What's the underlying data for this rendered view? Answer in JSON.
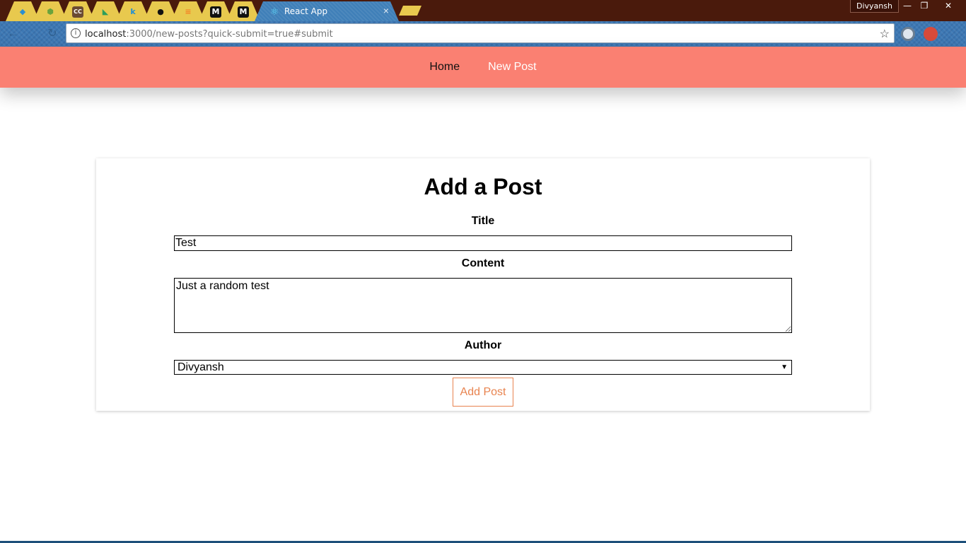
{
  "browser": {
    "tabs": [
      {
        "name": "tab-1",
        "icon": "bird-icon",
        "glyph": "◆",
        "color": "#2b8fd1"
      },
      {
        "name": "tab-2",
        "icon": "nodejs-icon",
        "glyph": "⬢",
        "color": "#6aa33c"
      },
      {
        "name": "tab-3",
        "icon": "cc-icon",
        "glyph": "CC",
        "color": "#6b4b33"
      },
      {
        "name": "tab-4",
        "icon": "maps-icon",
        "glyph": "◣",
        "color": "#2e9e5b"
      },
      {
        "name": "tab-5",
        "icon": "k-icon",
        "glyph": "k",
        "color": "#1e8ed6"
      },
      {
        "name": "tab-6",
        "icon": "github-icon",
        "glyph": "●",
        "color": "#111111"
      },
      {
        "name": "tab-7",
        "icon": "stackoverflow-icon",
        "glyph": "≡",
        "color": "#f48024"
      },
      {
        "name": "tab-8",
        "icon": "medium-icon",
        "glyph": "M",
        "color": "#111111"
      },
      {
        "name": "tab-9",
        "icon": "medium-icon",
        "glyph": "M",
        "color": "#111111"
      }
    ],
    "active_tab": {
      "title": "React App",
      "icon": "react-icon",
      "close": "×"
    },
    "profile_name": "Divyansh",
    "window_controls": {
      "minimize": "—",
      "restore": "❐",
      "close": "✕"
    },
    "url_host": "localhost",
    "url_rest": ":3000/new-posts?quick-submit=true#submit",
    "info_glyph": "i",
    "star_glyph": "☆",
    "back_glyph": "←",
    "reload_glyph": "↻"
  },
  "nav": {
    "home": "Home",
    "new_post": "New Post"
  },
  "form": {
    "heading": "Add a Post",
    "title_label": "Title",
    "title_value": "Test",
    "content_label": "Content",
    "content_value": "Just a random test",
    "author_label": "Author",
    "author_selected": "Divyansh",
    "submit_label": "Add Post"
  },
  "colors": {
    "nav_bg": "#fa8072",
    "button_accent": "#e8834f",
    "tab_yellow": "#e8c94e",
    "tabstrip_bg": "#4a1a0c"
  }
}
